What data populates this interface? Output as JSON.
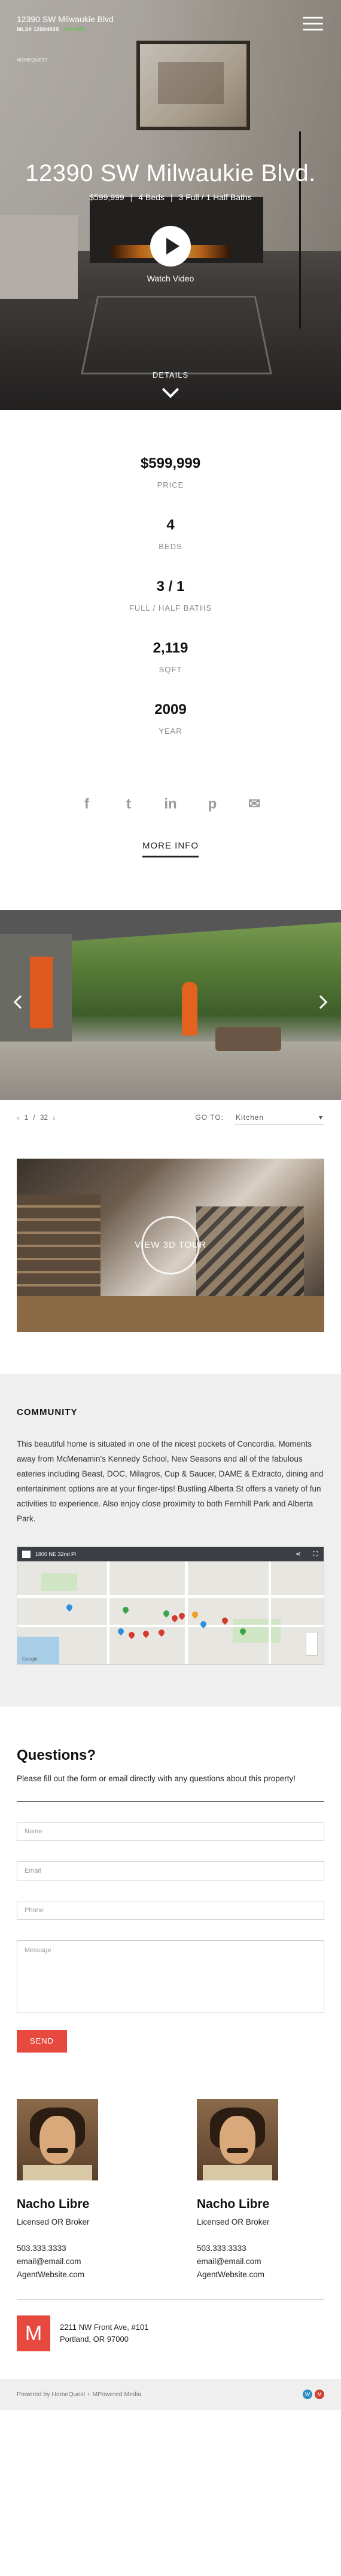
{
  "header": {
    "address": "12390 SW Milwaukie Blvd",
    "mls_label": "MLS# 12884829",
    "status": "ACTIVE",
    "small_logo": "HOMEQUEST"
  },
  "hero": {
    "title": "12390 SW Milwaukie Blvd.",
    "price": "$599,999",
    "beds": "4 Beds",
    "baths": "3 Full / 1 Half Baths",
    "watch_label": "Watch Video",
    "details_label": "DETAILS"
  },
  "stats": [
    {
      "value": "$599,999",
      "label": "PRICE"
    },
    {
      "value": "4",
      "label": "BEDS"
    },
    {
      "value": "3 / 1",
      "label": "FULL / HALF BATHS"
    },
    {
      "value": "2,119",
      "label": "SQFT"
    },
    {
      "value": "2009",
      "label": "YEAR"
    }
  ],
  "social": {
    "facebook": "f",
    "twitter": "t",
    "linkedin": "in",
    "pinterest": "p",
    "email": "✉"
  },
  "more_info": "MORE INFO",
  "gallery": {
    "current": "1",
    "separator": "/",
    "total": "32",
    "goto_label": "GO TO:",
    "goto_value": "Kitchen"
  },
  "tour": {
    "label": "VIEW 3D TOUR"
  },
  "community": {
    "heading": "COMMUNITY",
    "text": "This beautiful home is situated in one of the nicest pockets of Concordia. Moments away from McMenamin's Kennedy School, New Seasons and all of the fabulous eateries including Beast, DOC, Milagros, Cup & Saucer, DAME & Extracto, dining and entertainment options are at your finger-tips! Bustling Alberta St offers a variety of fun activities to experience. Also enjoy close proximity to both Fernhill Park and Alberta Park.",
    "map_title": "1800 NE 32nd Pl",
    "map_credit": "Google"
  },
  "contact": {
    "heading": "Questions?",
    "intro": "Please fill out the form or email directly with any questions about this property!",
    "name_placeholder": "Name",
    "email_placeholder": "Email",
    "phone_placeholder": "Phone",
    "message_placeholder": "Message",
    "send_label": "SEND"
  },
  "agents": [
    {
      "name": "Nacho Libre",
      "role": "Licensed OR Broker",
      "phone": "503.333.3333",
      "email": "email@email.com",
      "website": "AgentWebsite.com"
    },
    {
      "name": "Nacho Libre",
      "role": "Licensed OR Broker",
      "phone": "503.333.3333",
      "email": "email@email.com",
      "website": "AgentWebsite.com"
    }
  ],
  "office": {
    "logo_letter": "M",
    "address_line1": "2211 NW Front Ave, #101",
    "address_line2": "Portland, OR 97000"
  },
  "footer": {
    "text": "Powered by HomeQuest + MPowered Media"
  },
  "colors": {
    "accent": "#e8493e",
    "status_green": "#5fc14e"
  }
}
